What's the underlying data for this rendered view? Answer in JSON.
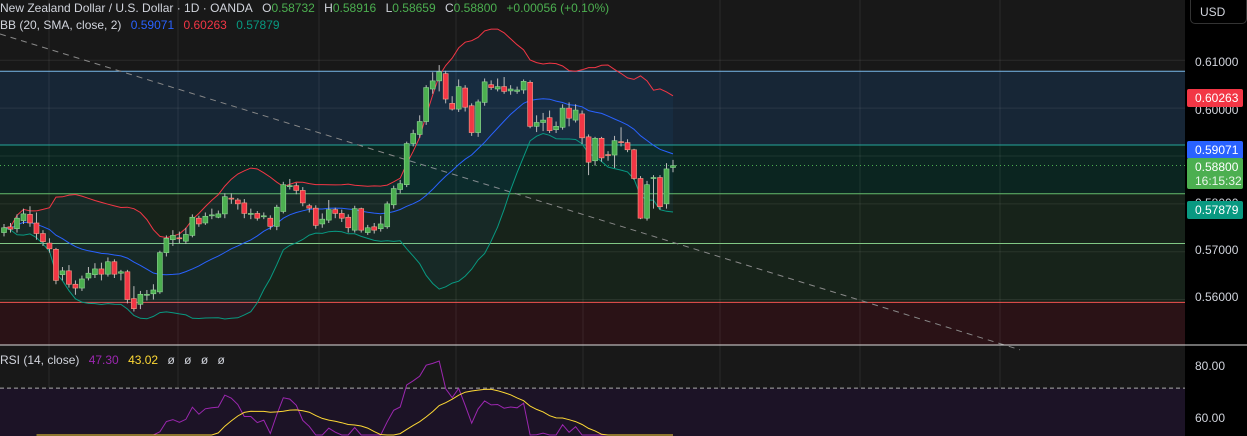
{
  "header": {
    "symbol": "New Zealand Dollar / U.S. Dollar · 1D · OANDA",
    "o_label": "O",
    "o": "0.58732",
    "h_label": "H",
    "h": "0.58916",
    "l_label": "L",
    "l": "0.58659",
    "c_label": "C",
    "c": "0.58800",
    "change": "+0.00056 (+0.10%)"
  },
  "bb_legend": {
    "label": "BB (20, SMA, close, 2)",
    "basis": "0.59071",
    "upper": "0.60263",
    "lower": "0.57879"
  },
  "rsi_legend": {
    "label": "RSI (14, close)",
    "rsi": "47.30",
    "ma": "43.02",
    "extra": [
      "ø",
      "ø",
      "ø",
      "ø"
    ]
  },
  "axis": {
    "currency_button": "USD",
    "price_ticks": [
      "0.61000",
      "0.60000",
      "0.57000",
      "0.56000"
    ],
    "rsi_ticks": [
      "80.00",
      "60.00"
    ],
    "badges": {
      "upper": "0.60263",
      "basis": "0.59071",
      "last": "0.58800",
      "countdown": "16:15:32",
      "lower": "0.57879",
      "hidden_tick": "0.58000"
    }
  },
  "colors": {
    "up": "#4caf50",
    "down": "#f23645",
    "basis": "#2962ff",
    "upper": "#f23645",
    "lower": "#089981",
    "rsi": "#7e57c2",
    "rsi_ma": "#fdd835"
  },
  "chart_data": {
    "type": "candlestick",
    "title": "New Zealand Dollar / U.S. Dollar · 1D · OANDA",
    "ylim": [
      0.5505,
      0.6226
    ],
    "rsi_ylim": [
      50,
      88
    ],
    "levels": {
      "zone_top": 0.6077,
      "zone_mid": 0.5923,
      "line_a": 0.5821,
      "line_b": 0.5717,
      "support_zone": 0.5594,
      "current": 0.588
    },
    "trendline": [
      [
        0,
        0.6155
      ],
      [
        1,
        0.5495
      ]
    ],
    "ohlc": [
      [
        0.574,
        0.5758,
        0.5732,
        0.575
      ],
      [
        0.5752,
        0.576,
        0.574,
        0.5747
      ],
      [
        0.5748,
        0.5778,
        0.574,
        0.577
      ],
      [
        0.5765,
        0.579,
        0.5758,
        0.5779
      ],
      [
        0.5778,
        0.5795,
        0.5752,
        0.576
      ],
      [
        0.576,
        0.5782,
        0.5725,
        0.5738
      ],
      [
        0.5738,
        0.5745,
        0.5712,
        0.5721
      ],
      [
        0.5718,
        0.5728,
        0.5698,
        0.5706
      ],
      [
        0.5705,
        0.5708,
        0.5632,
        0.564
      ],
      [
        0.5652,
        0.5668,
        0.564,
        0.566
      ],
      [
        0.566,
        0.5672,
        0.5625,
        0.5632
      ],
      [
        0.5632,
        0.564,
        0.561,
        0.5624
      ],
      [
        0.5624,
        0.565,
        0.5618,
        0.5643
      ],
      [
        0.5645,
        0.5668,
        0.564,
        0.5655
      ],
      [
        0.5652,
        0.5676,
        0.5645,
        0.5664
      ],
      [
        0.5664,
        0.5677,
        0.564,
        0.5653
      ],
      [
        0.5653,
        0.5688,
        0.5648,
        0.5679
      ],
      [
        0.5679,
        0.5684,
        0.5645,
        0.5653
      ],
      [
        0.5655,
        0.5662,
        0.564,
        0.5658
      ],
      [
        0.5658,
        0.5662,
        0.5592,
        0.56
      ],
      [
        0.5602,
        0.5628,
        0.5575,
        0.5581
      ],
      [
        0.559,
        0.5618,
        0.558,
        0.5611
      ],
      [
        0.561,
        0.562,
        0.5598,
        0.5611
      ],
      [
        0.5612,
        0.5632,
        0.56,
        0.562
      ],
      [
        0.5616,
        0.5702,
        0.5612,
        0.5698
      ],
      [
        0.5698,
        0.5734,
        0.569,
        0.5728
      ],
      [
        0.5725,
        0.5745,
        0.5712,
        0.5734
      ],
      [
        0.5729,
        0.5742,
        0.5718,
        0.5728
      ],
      [
        0.5722,
        0.575,
        0.5716,
        0.5736
      ],
      [
        0.5734,
        0.5778,
        0.573,
        0.5772
      ],
      [
        0.577,
        0.5775,
        0.5752,
        0.5758
      ],
      [
        0.576,
        0.5782,
        0.5756,
        0.5774
      ],
      [
        0.5776,
        0.579,
        0.5768,
        0.5777
      ],
      [
        0.5772,
        0.5786,
        0.577,
        0.5779
      ],
      [
        0.5779,
        0.5822,
        0.577,
        0.5815
      ],
      [
        0.5812,
        0.5822,
        0.58,
        0.581
      ],
      [
        0.5808,
        0.5812,
        0.5788,
        0.58
      ],
      [
        0.5802,
        0.581,
        0.577,
        0.578
      ],
      [
        0.578,
        0.579,
        0.5768,
        0.578
      ],
      [
        0.578,
        0.5785,
        0.5765,
        0.577
      ],
      [
        0.5774,
        0.5782,
        0.5768,
        0.5775
      ],
      [
        0.577,
        0.5776,
        0.5746,
        0.5753
      ],
      [
        0.5753,
        0.5798,
        0.5745,
        0.5793
      ],
      [
        0.5784,
        0.5846,
        0.578,
        0.584
      ],
      [
        0.5836,
        0.5852,
        0.583,
        0.5838
      ],
      [
        0.5838,
        0.5844,
        0.582,
        0.5828
      ],
      [
        0.5828,
        0.5835,
        0.5795,
        0.5802
      ],
      [
        0.5796,
        0.58,
        0.5782,
        0.5791
      ],
      [
        0.5791,
        0.5797,
        0.5748,
        0.5755
      ],
      [
        0.5758,
        0.578,
        0.575,
        0.5768
      ],
      [
        0.5766,
        0.5808,
        0.576,
        0.5788
      ],
      [
        0.5788,
        0.5792,
        0.577,
        0.578
      ],
      [
        0.578,
        0.5788,
        0.5762,
        0.577
      ],
      [
        0.5772,
        0.5778,
        0.574,
        0.575
      ],
      [
        0.5745,
        0.5796,
        0.574,
        0.579
      ],
      [
        0.579,
        0.5792,
        0.574,
        0.5745
      ],
      [
        0.574,
        0.5756,
        0.5735,
        0.575
      ],
      [
        0.5752,
        0.576,
        0.5738,
        0.5745
      ],
      [
        0.5748,
        0.5775,
        0.5742,
        0.5758
      ],
      [
        0.5752,
        0.5805,
        0.5748,
        0.58
      ],
      [
        0.5798,
        0.5838,
        0.579,
        0.5832
      ],
      [
        0.583,
        0.585,
        0.5822,
        0.5842
      ],
      [
        0.584,
        0.593,
        0.5835,
        0.5926
      ],
      [
        0.5926,
        0.5955,
        0.592,
        0.5947
      ],
      [
        0.5945,
        0.5985,
        0.5938,
        0.5972
      ],
      [
        0.5972,
        0.6048,
        0.5965,
        0.6043
      ],
      [
        0.604,
        0.6075,
        0.603,
        0.6057
      ],
      [
        0.6057,
        0.609,
        0.6035,
        0.6076
      ],
      [
        0.6072,
        0.6078,
        0.601,
        0.6019
      ],
      [
        0.601,
        0.6025,
        0.5995,
        0.5998
      ],
      [
        0.5998,
        0.606,
        0.5992,
        0.6045
      ],
      [
        0.6042,
        0.6048,
        0.5993,
        0.6002
      ],
      [
        0.6005,
        0.601,
        0.5942,
        0.5949
      ],
      [
        0.5949,
        0.6018,
        0.594,
        0.6013
      ],
      [
        0.6012,
        0.6062,
        0.6005,
        0.6055
      ],
      [
        0.6049,
        0.6058,
        0.6038,
        0.6043
      ],
      [
        0.604,
        0.6062,
        0.6035,
        0.6045
      ],
      [
        0.6045,
        0.6065,
        0.603,
        0.6035
      ],
      [
        0.6036,
        0.6048,
        0.6028,
        0.604
      ],
      [
        0.6035,
        0.6045,
        0.603,
        0.6038
      ],
      [
        0.6038,
        0.606,
        0.603,
        0.6056
      ],
      [
        0.6054,
        0.6058,
        0.5958,
        0.5962
      ],
      [
        0.5962,
        0.5985,
        0.595,
        0.597
      ],
      [
        0.597,
        0.599,
        0.5952,
        0.5975
      ],
      [
        0.598,
        0.5995,
        0.5948,
        0.5953
      ],
      [
        0.5955,
        0.5972,
        0.5948,
        0.5962
      ],
      [
        0.596,
        0.6008,
        0.5955,
        0.6
      ],
      [
        0.6,
        0.6012,
        0.5962,
        0.5979
      ],
      [
        0.5975,
        0.6008,
        0.597,
        0.5996
      ],
      [
        0.5988,
        0.5995,
        0.5925,
        0.5938
      ],
      [
        0.594,
        0.5945,
        0.586,
        0.5887
      ],
      [
        0.589,
        0.594,
        0.588,
        0.5937
      ],
      [
        0.5937,
        0.594,
        0.5888,
        0.5896
      ],
      [
        0.5903,
        0.591,
        0.589,
        0.5902
      ],
      [
        0.5902,
        0.5942,
        0.5875,
        0.5932
      ],
      [
        0.593,
        0.596,
        0.592,
        0.5928
      ],
      [
        0.5928,
        0.5935,
        0.5908,
        0.5913
      ],
      [
        0.5913,
        0.5915,
        0.585,
        0.5853
      ],
      [
        0.5853,
        0.5858,
        0.5768,
        0.577
      ],
      [
        0.577,
        0.5848,
        0.5765,
        0.584
      ],
      [
        0.5855,
        0.586,
        0.579,
        0.5855
      ],
      [
        0.5855,
        0.586,
        0.5788,
        0.5794
      ],
      [
        0.58,
        0.5885,
        0.579,
        0.5873
      ],
      [
        0.5876,
        0.5892,
        0.5866,
        0.588
      ]
    ]
  }
}
